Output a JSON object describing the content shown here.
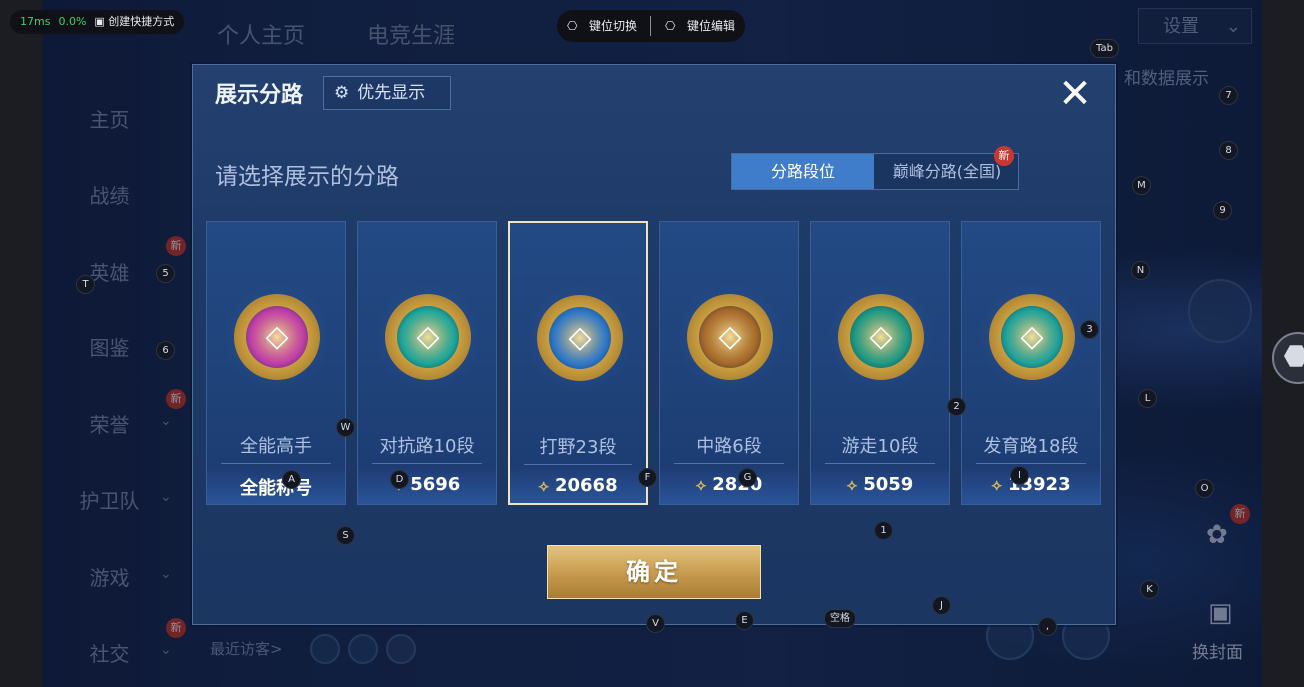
{
  "perf": {
    "latency": "17ms",
    "loss": "0.0%",
    "shortcut": "创建快捷方式"
  },
  "keybar": {
    "switch": "键位切换",
    "edit": "键位编辑"
  },
  "top_tabs": [
    "个人主页",
    "电竞生涯"
  ],
  "settings": "设置",
  "data_display": "和数据展示",
  "left_menu": [
    {
      "label": "主页",
      "arrow": ""
    },
    {
      "label": "战绩",
      "arrow": ""
    },
    {
      "label": "英雄",
      "arrow": "",
      "badge": "新"
    },
    {
      "label": "图鉴",
      "arrow": ""
    },
    {
      "label": "荣誉",
      "arrow": "⌄",
      "badge": "新"
    },
    {
      "label": "护卫队",
      "arrow": "⌄"
    },
    {
      "label": "游戏",
      "arrow": "⌄"
    },
    {
      "label": "社交",
      "arrow": "⌄",
      "badge": "新"
    }
  ],
  "recent_visitors": "最近访客>",
  "change_cover": "换封面",
  "modal": {
    "title": "展示分路",
    "priority": "优先显示",
    "prompt": "请选择展示的分路",
    "tab_a": "分路段位",
    "tab_b": "巅峰分路(全国)",
    "tab_b_badge": "新",
    "confirm": "确定",
    "cards": [
      {
        "name": "全能高手",
        "score": "全能称号",
        "show_mark": false,
        "color": "#c23fa8"
      },
      {
        "name": "对抗路10段",
        "score": "5696",
        "show_mark": true,
        "color": "#1fa79a"
      },
      {
        "name": "打野23段",
        "score": "20668",
        "show_mark": true,
        "color": "#2e78c9"
      },
      {
        "name": "中路6段",
        "score": "2820",
        "show_mark": true,
        "color": "#a86a2a"
      },
      {
        "name": "游走10段",
        "score": "5059",
        "show_mark": true,
        "color": "#1f9a84"
      },
      {
        "name": "发育路18段",
        "score": "13923",
        "show_mark": true,
        "color": "#1fa39b"
      }
    ],
    "selected_index": 2
  },
  "hints": [
    "Tab",
    "7",
    "8",
    "M",
    "9",
    "N",
    "3",
    "2",
    "L",
    "O",
    "1",
    "K",
    "J",
    "空格",
    "E",
    "V",
    "S",
    "W",
    "A",
    "D",
    "F",
    "G",
    "I",
    "T",
    "5",
    "6",
    ","
  ]
}
